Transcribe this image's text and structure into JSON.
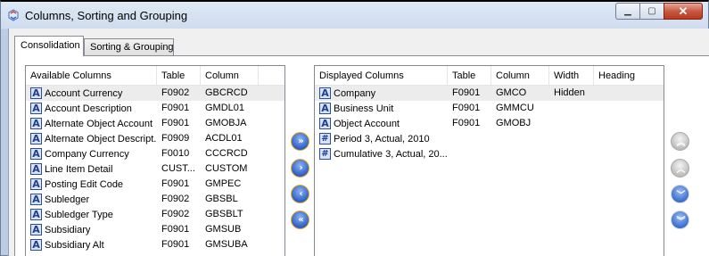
{
  "window": {
    "title": "Columns, Sorting and Grouping",
    "icon": "app-logo-icon",
    "minimize": "minimize-icon",
    "maximize": "maximize-icon",
    "close": "close-icon"
  },
  "tabs": [
    {
      "label": "Consolidation",
      "active": true
    },
    {
      "label": "Sorting & Grouping",
      "active": false
    }
  ],
  "available": {
    "headers": [
      "Available Columns",
      "Table",
      "Column"
    ],
    "rows": [
      {
        "type": "A",
        "name": "Account Currency",
        "table": "F0902",
        "column": "GBCRCD",
        "selected": true
      },
      {
        "type": "A",
        "name": "Account Description",
        "table": "F0901",
        "column": "GMDL01"
      },
      {
        "type": "A",
        "name": "Alternate Object Account",
        "table": "F0901",
        "column": "GMOBJA"
      },
      {
        "type": "A",
        "name": "Alternate Object Descript...",
        "table": "F0909",
        "column": "ACDL01"
      },
      {
        "type": "A",
        "name": "Company Currency",
        "table": "F0010",
        "column": "CCCRCD"
      },
      {
        "type": "A",
        "name": "Line Item Detail",
        "table": "CUST...",
        "column": "CUSTOM"
      },
      {
        "type": "A",
        "name": "Posting Edit Code",
        "table": "F0901",
        "column": "GMPEC"
      },
      {
        "type": "A",
        "name": "Subledger",
        "table": "F0902",
        "column": "GBSBL"
      },
      {
        "type": "A",
        "name": "Subledger Type",
        "table": "F0902",
        "column": "GBSBLT"
      },
      {
        "type": "A",
        "name": "Subsidiary",
        "table": "F0901",
        "column": "GMSUB"
      },
      {
        "type": "A",
        "name": "Subsidiary Alt",
        "table": "F0901",
        "column": "GMSUBA"
      }
    ]
  },
  "displayed": {
    "headers": [
      "Displayed Columns",
      "Table",
      "Column",
      "Width",
      "Heading"
    ],
    "rows": [
      {
        "type": "A",
        "name": "Company",
        "table": "F0901",
        "column": "GMCO",
        "width": "Hidden",
        "heading": "",
        "selected": true
      },
      {
        "type": "A",
        "name": "Business Unit",
        "table": "F0901",
        "column": "GMMCU",
        "width": "",
        "heading": ""
      },
      {
        "type": "A",
        "name": "Object Account",
        "table": "F0901",
        "column": "GMOBJ",
        "width": "",
        "heading": ""
      },
      {
        "type": "#",
        "name": "Period 3, Actual, 2010",
        "table": "",
        "column": "",
        "width": "",
        "heading": ""
      },
      {
        "type": "#",
        "name": "Cumulative 3, Actual, 20...",
        "table": "",
        "column": "",
        "width": "",
        "heading": ""
      }
    ]
  },
  "transfer_buttons": [
    {
      "name": "add-all-button",
      "icon": "double-chevron-right-icon",
      "glyph": "»"
    },
    {
      "name": "add-selected-button",
      "icon": "chevron-right-icon",
      "glyph": "›"
    },
    {
      "name": "remove-selected-button",
      "icon": "chevron-left-icon",
      "glyph": "‹"
    },
    {
      "name": "remove-all-button",
      "icon": "double-chevron-left-icon",
      "glyph": "«"
    }
  ],
  "order_buttons": [
    {
      "name": "move-to-top-button",
      "icon": "double-chevron-up-icon",
      "glyph": "︽",
      "enabled": false
    },
    {
      "name": "move-up-button",
      "icon": "chevron-up-icon",
      "glyph": "︿",
      "enabled": false
    },
    {
      "name": "move-down-button",
      "icon": "chevron-down-icon",
      "glyph": "﹀",
      "enabled": true
    },
    {
      "name": "move-to-bottom-button",
      "icon": "double-chevron-down-icon",
      "glyph": "︾",
      "enabled": true
    }
  ]
}
